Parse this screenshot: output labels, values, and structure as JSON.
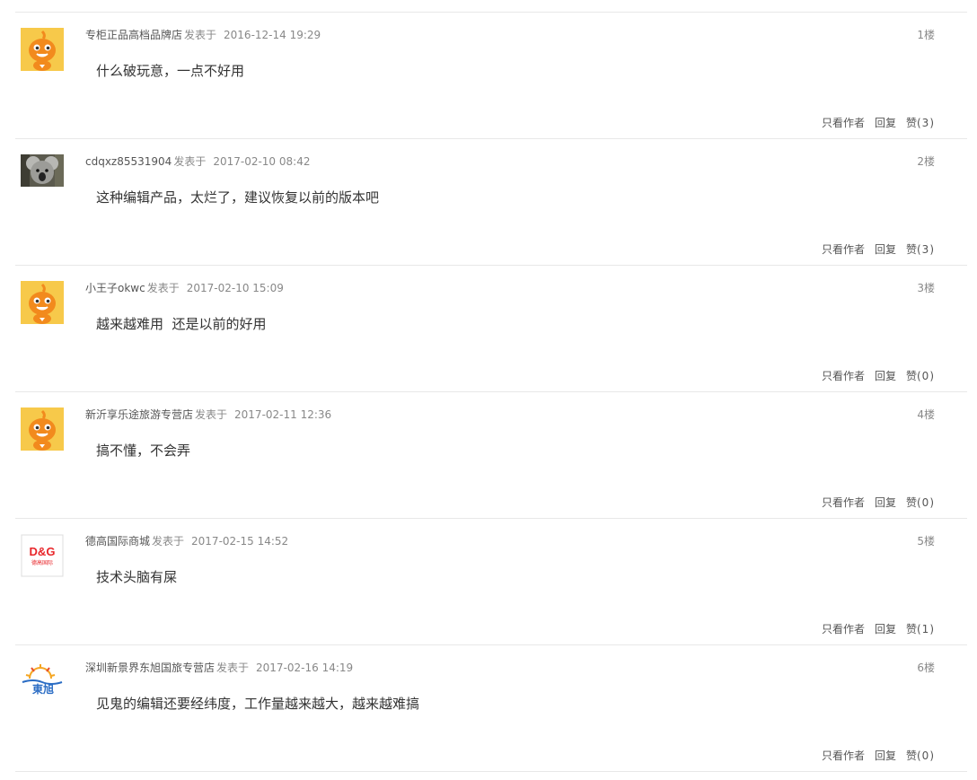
{
  "labels": {
    "posted_at": "发表于",
    "only_author": "只看作者",
    "reply": "回复",
    "like": "赞"
  },
  "posts": [
    {
      "author": "专柜正品高档品牌店",
      "time": "2016-12-14 19:29",
      "floor": "1楼",
      "content": "什么破玩意，一点不好用",
      "likes": "(3)",
      "avatar": "orange-mascot-avatar"
    },
    {
      "author": "cdqxz85531904",
      "time": "2017-02-10 08:42",
      "floor": "2楼",
      "content": "这种编辑产品，太烂了，建议恢复以前的版本吧",
      "likes": "(3)",
      "avatar": "koala-photo-avatar"
    },
    {
      "author": "小王子okwc",
      "time": "2017-02-10 15:09",
      "floor": "3楼",
      "content": "越来越难用  还是以前的好用",
      "likes": "(0)",
      "avatar": "orange-mascot-avatar"
    },
    {
      "author": "新沂享乐途旅游专营店",
      "time": "2017-02-11 12:36",
      "floor": "4楼",
      "content": "搞不懂，不会弄",
      "likes": "(0)",
      "avatar": "orange-mascot-avatar"
    },
    {
      "author": "德高国际商城",
      "time": "2017-02-15 14:52",
      "floor": "5楼",
      "content": "技术头脑有屎",
      "likes": "(1)",
      "avatar": "dg-logo-avatar",
      "logo_text": "D&G",
      "logo_subtext": "德高国际"
    },
    {
      "author": "深圳新景界东旭国旅专营店",
      "time": "2017-02-16 14:19",
      "floor": "6楼",
      "content": "见鬼的编辑还要经纬度，工作量越来越大，越来越难搞",
      "likes": "(0)",
      "avatar": "dongxu-logo-avatar",
      "logo_text": "東旭"
    }
  ],
  "colors": {
    "mascot_bg": "#f7c94a",
    "mascot_body": "#f28a1d",
    "divider": "#e8e8e8",
    "dg_red": "#e8262a",
    "dongxu_blue": "#2a6cc4"
  }
}
